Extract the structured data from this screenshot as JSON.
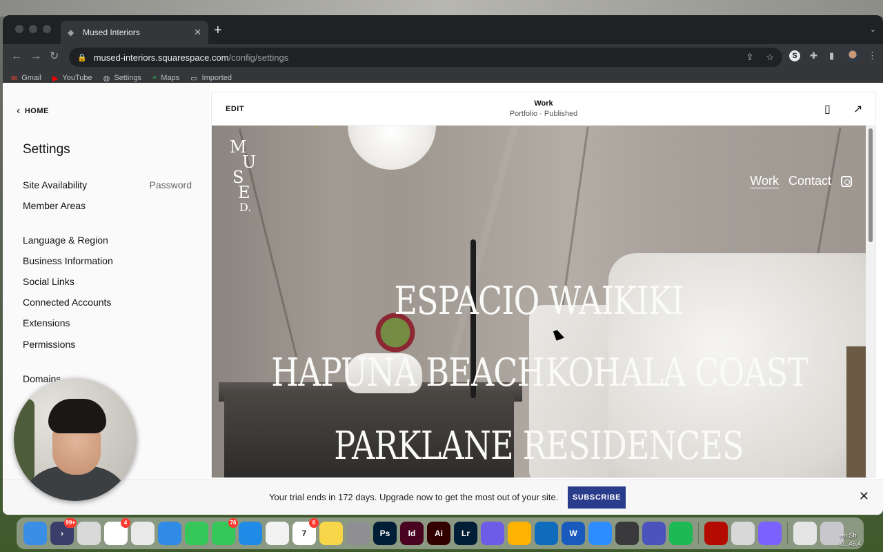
{
  "browser": {
    "tab_title": "Mused Interiors",
    "url_host": "mused-interiors.squarespace.com",
    "url_path": "/config/settings",
    "bookmarks": [
      {
        "label": "Gmail",
        "icon": "gmail-icon"
      },
      {
        "label": "YouTube",
        "icon": "youtube-icon"
      },
      {
        "label": "Settings",
        "icon": "globe-icon"
      },
      {
        "label": "Maps",
        "icon": "maps-icon"
      },
      {
        "label": "Imported",
        "icon": "folder-icon"
      }
    ],
    "profile_initial": "S"
  },
  "sidebar": {
    "home_label": "HOME",
    "title": "Settings",
    "items": [
      {
        "label": "Site Availability",
        "meta": "Password"
      },
      {
        "label": "Member Areas"
      },
      {
        "label": "Language & Region"
      },
      {
        "label": "Business Information"
      },
      {
        "label": "Social Links"
      },
      {
        "label": "Connected Accounts"
      },
      {
        "label": "Extensions"
      },
      {
        "label": "Permissions"
      },
      {
        "label": "Domains"
      }
    ]
  },
  "preview": {
    "edit_label": "EDIT",
    "page_title": "Work",
    "page_status": "Portfolio · Published",
    "site": {
      "logo_letters": [
        "M",
        "U",
        "S",
        "E",
        "D."
      ],
      "nav": [
        "Work",
        "Contact"
      ],
      "projects": [
        "ESPACIO WAIKIKI",
        "HAPUNA BEACH",
        "KOHALA COAST",
        "PARKLANE RESIDENCES"
      ]
    }
  },
  "trial": {
    "message": "Your trial ends in 172 days. Upgrade now to get the most out of your site.",
    "button": "SUBSCRIBE"
  },
  "dock": {
    "apps": [
      {
        "name": "finder-icon",
        "color": "#3a8ee6",
        "label": ""
      },
      {
        "name": "shortcut-icon",
        "color": "#3b3e6a",
        "label": "›",
        "badge": "99+"
      },
      {
        "name": "launchpad-icon",
        "color": "#d9d9d9",
        "label": ""
      },
      {
        "name": "slack-icon",
        "color": "#ffffff",
        "label": "",
        "badge": "4"
      },
      {
        "name": "chrome-icon",
        "color": "#e9e9e9",
        "label": ""
      },
      {
        "name": "safari-icon",
        "color": "#2f8be6",
        "label": ""
      },
      {
        "name": "facetime-icon",
        "color": "#35c759",
        "label": ""
      },
      {
        "name": "messages-icon",
        "color": "#35c759",
        "label": "",
        "badge": "76"
      },
      {
        "name": "keynote-icon",
        "color": "#1f8be6",
        "label": ""
      },
      {
        "name": "photos-icon",
        "color": "#f2f2f2",
        "label": ""
      },
      {
        "name": "calendar-icon",
        "color": "#ffffff",
        "label": "7",
        "badge": "6"
      },
      {
        "name": "notes-icon",
        "color": "#f7d64a",
        "label": ""
      },
      {
        "name": "system-settings-icon",
        "color": "#8e8e93",
        "label": ""
      },
      {
        "name": "photoshop-icon",
        "color": "#001e36",
        "label": "Ps"
      },
      {
        "name": "indesign-icon",
        "color": "#49021f",
        "label": "Id"
      },
      {
        "name": "illustrator-icon",
        "color": "#330000",
        "label": "Ai"
      },
      {
        "name": "lightroom-icon",
        "color": "#001e36",
        "label": "Lr"
      },
      {
        "name": "affinity-icon",
        "color": "#6c5ce7",
        "label": ""
      },
      {
        "name": "sketch-icon",
        "color": "#fdb300",
        "label": ""
      },
      {
        "name": "outlook-icon",
        "color": "#0f6cbd",
        "label": ""
      },
      {
        "name": "word-icon",
        "color": "#185abd",
        "label": "W"
      },
      {
        "name": "zoom-icon",
        "color": "#2d8cff",
        "label": ""
      },
      {
        "name": "quicktime-icon",
        "color": "#3a3a3c",
        "label": ""
      },
      {
        "name": "teams-icon",
        "color": "#4b53bc",
        "label": ""
      },
      {
        "name": "spotify-icon",
        "color": "#1db954",
        "label": ""
      },
      {
        "name": "acrobat-icon",
        "color": "#b30b00",
        "label": ""
      },
      {
        "name": "preview-icon",
        "color": "#d8d8d8",
        "label": ""
      },
      {
        "name": "affinity-photo-icon",
        "color": "#7b61ff",
        "label": ""
      },
      {
        "name": "document-icon",
        "color": "#e5e5e5",
        "label": ""
      },
      {
        "name": "trash-icon",
        "color": "#c7c7cc",
        "label": ""
      }
    ]
  },
  "desktop": {
    "screenshot_label_line1": "en Sh",
    "screenshot_label_line2": "0...46.4"
  }
}
